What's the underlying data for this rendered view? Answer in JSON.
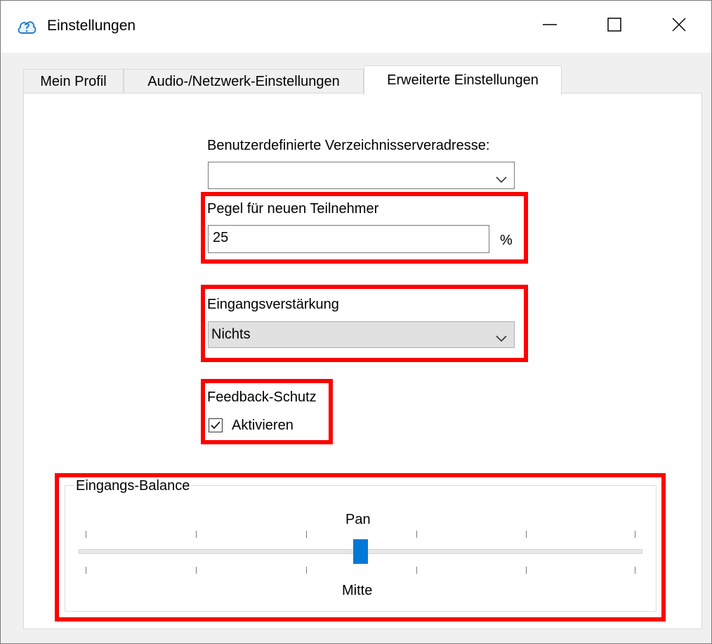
{
  "window": {
    "title": "Einstellungen",
    "app_icon": "app-cloud-icon",
    "controls": [
      "minimize-icon",
      "maximize-icon",
      "close-icon"
    ]
  },
  "tabs": [
    {
      "label": "Mein Profil",
      "active": false
    },
    {
      "label": "Audio-/Netzwerk-Einstellungen",
      "active": false
    },
    {
      "label": "Erweiterte Einstellungen",
      "active": true
    }
  ],
  "directory_server": {
    "label": "Benutzerdefinierte Verzeichnisserveradresse:",
    "value": ""
  },
  "new_participant_level": {
    "label": "Pegel für neuen Teilnehmer",
    "value": "25",
    "unit": "%"
  },
  "input_gain": {
    "label": "Eingangsverstärkung",
    "value": "Nichts"
  },
  "feedback_protection": {
    "label": "Feedback-Schutz",
    "checkbox_label": "Aktivieren",
    "checked": true
  },
  "input_balance": {
    "group_label": "Eingangs-Balance",
    "slider_label": "Pan",
    "value_label": "Mitte",
    "position": 0.5
  },
  "colors": {
    "highlight": "#ff0000",
    "slider_thumb": "#0078d7"
  }
}
